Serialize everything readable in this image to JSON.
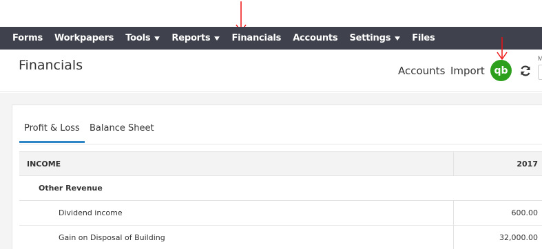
{
  "nav": {
    "items": [
      {
        "label": "Forms",
        "caret": false
      },
      {
        "label": "Workpapers",
        "caret": false
      },
      {
        "label": "Tools",
        "caret": true
      },
      {
        "label": "Reports",
        "caret": true
      },
      {
        "label": "Financials",
        "caret": false
      },
      {
        "label": "Accounts",
        "caret": false
      },
      {
        "label": "Settings",
        "caret": true
      },
      {
        "label": "Files",
        "caret": false
      }
    ]
  },
  "header": {
    "title": "Financials",
    "accounts_link": "Accounts",
    "import_link": "Import",
    "qb_label": "qb",
    "cut_label": "M"
  },
  "tabs": [
    {
      "label": "Profit & Loss",
      "active": true
    },
    {
      "label": "Balance Sheet",
      "active": false
    }
  ],
  "table": {
    "header": {
      "label": "INCOME",
      "year": "2017"
    },
    "group": "Other Revenue",
    "rows": [
      {
        "label": "Dividend income",
        "amount": "600.00"
      },
      {
        "label": "Gain on Disposal of Building",
        "amount": "32,000.00"
      }
    ]
  },
  "colors": {
    "nav_bg": "#3f424c",
    "qb_green": "#2ca01c",
    "tab_active": "#2f86c7",
    "annotation": "#e11111"
  }
}
